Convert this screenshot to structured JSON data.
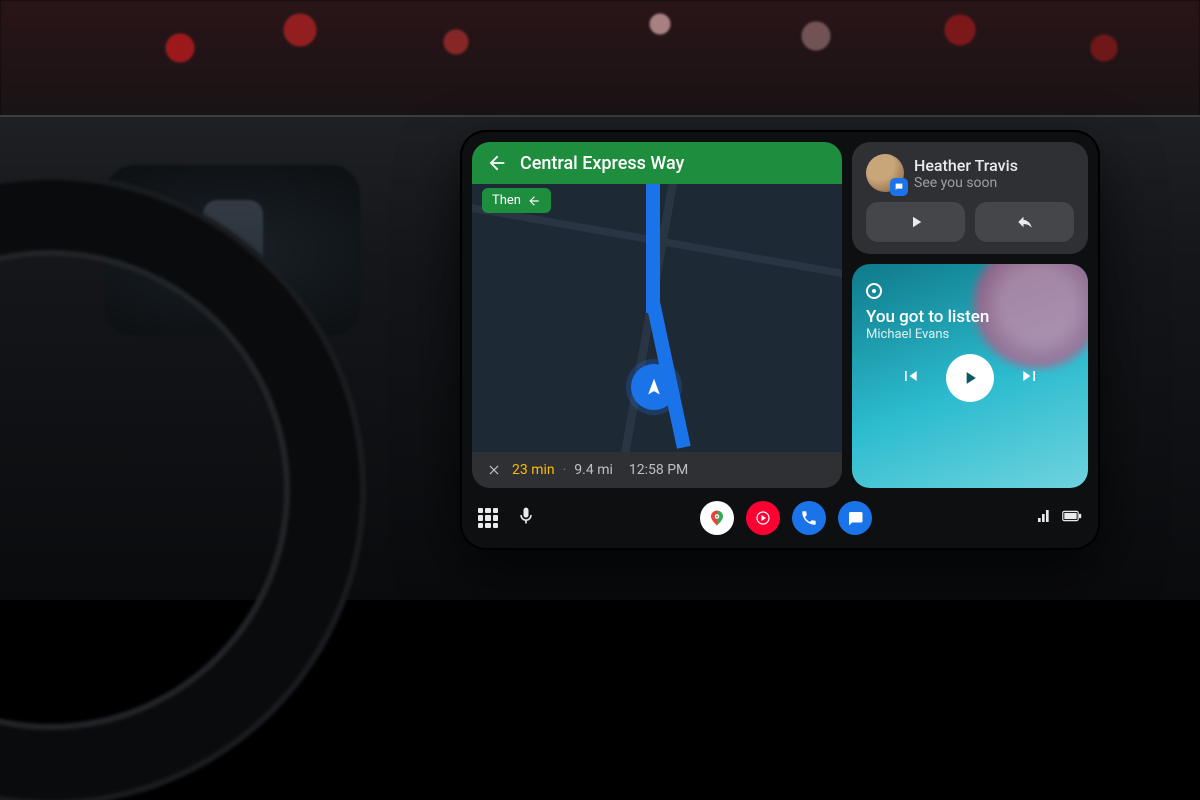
{
  "navigation": {
    "direction_label": "Central Express Way",
    "then_label": "Then",
    "eta_duration": "23 min",
    "eta_distance": "9.4 mi",
    "eta_time": "12:58 PM"
  },
  "message": {
    "sender": "Heather Travis",
    "preview": "See you soon"
  },
  "music": {
    "track": "You got to listen",
    "artist": "Michael Evans"
  },
  "apps": {
    "maps": "Google Maps",
    "youtube_music": "YouTube Music",
    "phone": "Phone",
    "messages": "Messages"
  },
  "status": {
    "signal": "signal",
    "battery": "battery"
  },
  "colors": {
    "nav_green": "#1e8e3e",
    "accent_blue": "#1a73e8",
    "eta_amber": "#fbbc04",
    "music_teal": "#2dbccf"
  }
}
